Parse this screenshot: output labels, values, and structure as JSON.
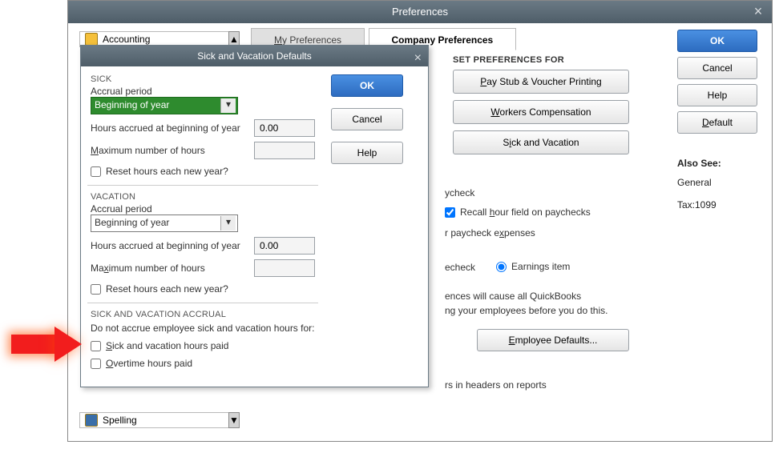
{
  "prefs": {
    "title": "Preferences",
    "tabs": {
      "my": "My Preferences",
      "company": "Company Preferences"
    },
    "buttons": {
      "ok": "OK",
      "cancel": "Cancel",
      "help": "Help",
      "default": "Default"
    },
    "also_see": {
      "label": "Also See:",
      "items": [
        "General",
        "Tax:1099"
      ]
    },
    "sidebar": {
      "accounting": "Accounting",
      "spelling": "Spelling"
    },
    "set_prefs_for": {
      "label": "SET PREFERENCES FOR",
      "paystub": "Pay Stub & Voucher Printing",
      "workers": "Workers Compensation",
      "sickvac": "Sick and Vacation"
    },
    "company": {
      "line1": "ycheck",
      "recall_hour": "Recall hour field on paychecks",
      "line2": "r paycheck expenses",
      "echeck": "echeck",
      "earnings": "Earnings item",
      "warn1": "ences will cause all QuickBooks",
      "warn2": "ng your employees before you do this.",
      "emp_defaults": "Employee Defaults...",
      "headers": "rs in headers on reports"
    }
  },
  "sv": {
    "title": "Sick and Vacation Defaults",
    "buttons": {
      "ok": "OK",
      "cancel": "Cancel",
      "help": "Help"
    },
    "sick": {
      "hdr": "SICK",
      "accrual_period_label": "Accrual period",
      "accrual_period_value": "Beginning of year",
      "hours_accrued_label": "Hours accrued at beginning of year",
      "hours_accrued_value": "0.00",
      "max_hours_label": "Maximum number of hours",
      "max_hours_value": "",
      "reset_label": "Reset hours each new year?"
    },
    "vacation": {
      "hdr": "VACATION",
      "accrual_period_label": "Accrual period",
      "accrual_period_value": "Beginning of year",
      "hours_accrued_label": "Hours accrued at beginning of year",
      "hours_accrued_value": "0.00",
      "max_hours_label": "Maximum number of hours",
      "max_hours_value": "",
      "reset_label": "Reset hours each new year?"
    },
    "accrual": {
      "hdr": "SICK AND VACATION ACCRUAL",
      "lead": "Do not accrue employee sick and vacation hours for:",
      "opt1": "Sick and vacation hours paid",
      "opt2": "Overtime hours paid"
    }
  }
}
